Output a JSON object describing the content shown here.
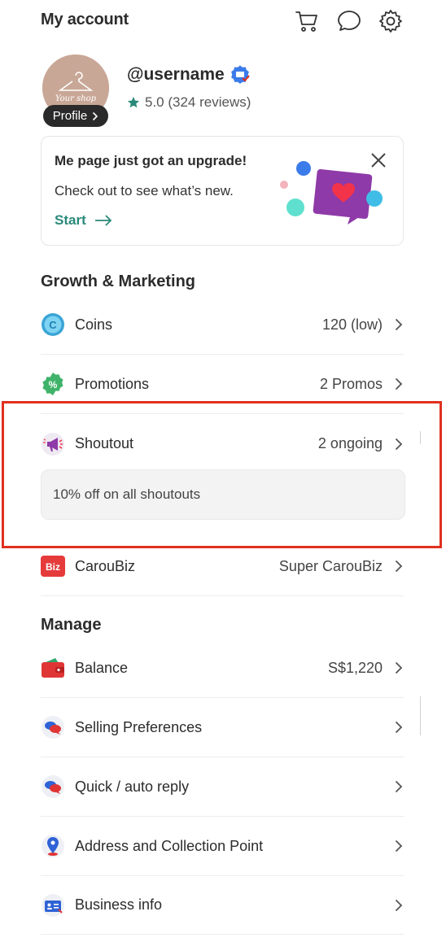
{
  "header": {
    "title": "My account",
    "icons": [
      "cart-icon",
      "chat-icon",
      "gear-icon"
    ]
  },
  "profile": {
    "username": "@username",
    "rating": "5.0 (324 reviews)",
    "profile_label": "Profile",
    "avatar_text": "Your shop"
  },
  "upgrade_card": {
    "title": "Me page just got an upgrade!",
    "subtitle": "Check out to see what’s new.",
    "cta": "Start"
  },
  "sections": {
    "growth": "Growth & Marketing",
    "manage": "Manage"
  },
  "growth_rows": [
    {
      "label": "Coins",
      "value": "120 (low)",
      "icon": "coin-icon"
    },
    {
      "label": "Promotions",
      "value": "2 Promos",
      "icon": "promotion-badge-icon"
    },
    {
      "label": "Shoutout",
      "value": "2 ongoing",
      "icon": "megaphone-icon"
    },
    {
      "label": "CarouBiz",
      "value": "Super CarouBiz",
      "icon": "biz-icon"
    }
  ],
  "shoutout_promo": "10% off on all shoutouts",
  "biz_badge": "Biz",
  "manage_rows": [
    {
      "label": "Balance",
      "value": "S$1,220",
      "icon": "wallet-icon"
    },
    {
      "label": "Selling Preferences",
      "value": "",
      "icon": "chat-bubbles-icon"
    },
    {
      "label": "Quick / auto reply",
      "value": "",
      "icon": "chat-bubbles-icon"
    },
    {
      "label": "Address and Collection Point",
      "value": "",
      "icon": "location-pin-icon"
    },
    {
      "label": "Business info",
      "value": "",
      "icon": "business-card-icon"
    }
  ],
  "colors": {
    "accent_green": "#2a8a7a",
    "highlight_red": "#e0301e",
    "verified_blue": "#3b7bea"
  }
}
